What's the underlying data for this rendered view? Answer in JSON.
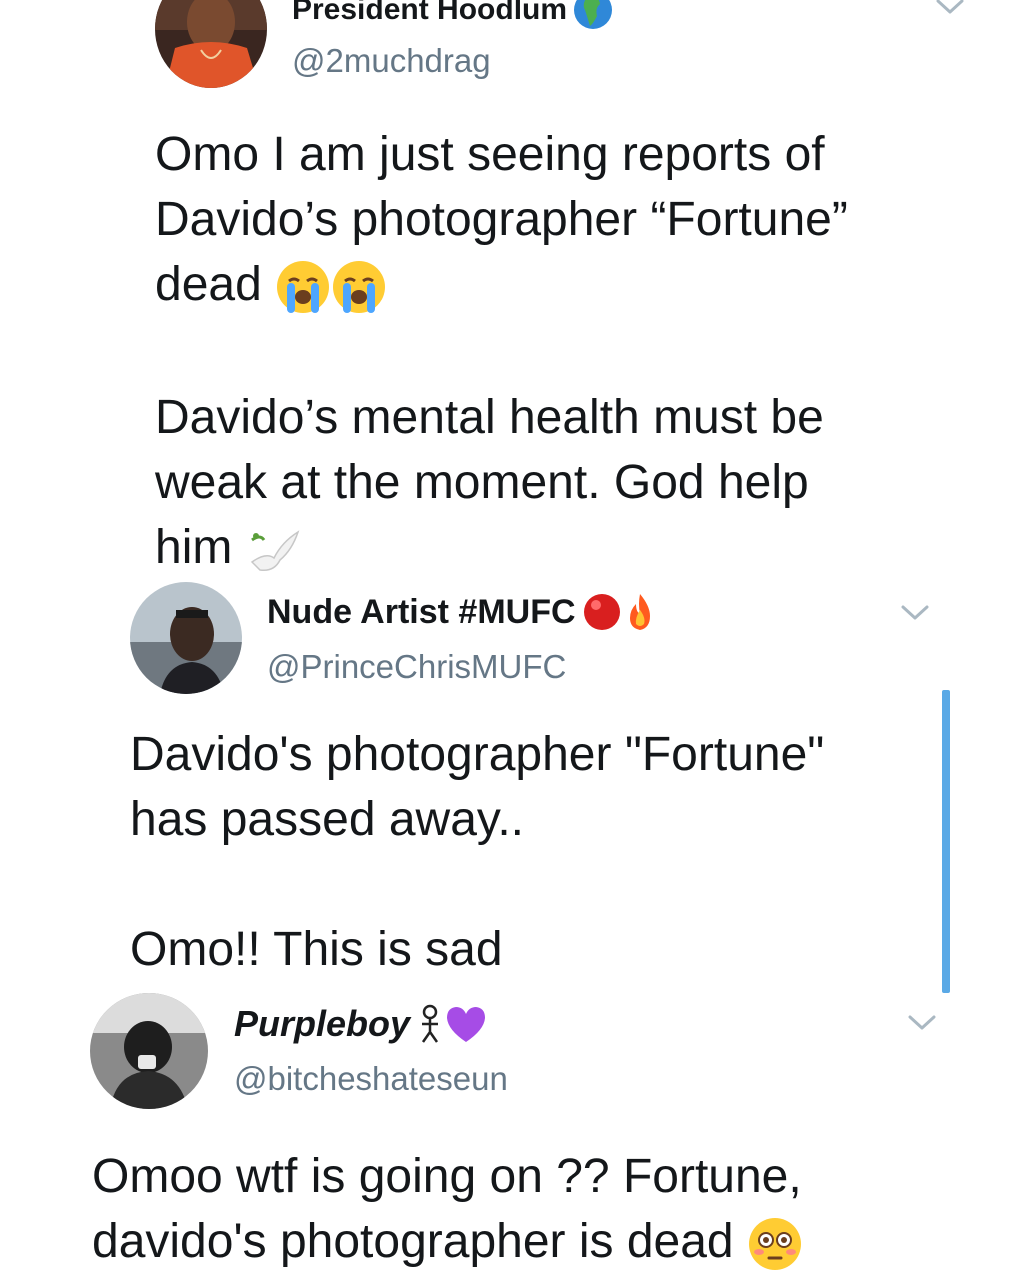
{
  "tweets": [
    {
      "name": "President Hoodlum",
      "name_emoji": "globe-africa-icon",
      "handle": "@2muchdrag",
      "paragraphs": [
        "Omo I am just seeing reports of\nDavido’s photographer “Fortune”\ndead",
        "Davido’s mental health must be\nweak at the moment. God help\nhim"
      ],
      "emojis": [
        "crying-face-icon",
        "crying-face-icon",
        "dove-icon"
      ]
    },
    {
      "name": "Nude Artist #MUFC",
      "name_emoji": [
        "red-circle-icon",
        "fire-icon"
      ],
      "handle": "@PrinceChrisMUFC",
      "paragraphs": [
        "Davido's photographer \"Fortune\"\nhas passed away..",
        "Omo!! This is sad"
      ]
    },
    {
      "name": "Purpleboy",
      "name_emoji": [
        "person-icon",
        "purple-heart-icon"
      ],
      "handle": "@bitcheshateseun",
      "paragraphs": [
        "Omoo wtf is going on ?? Fortune,\ndavido's photographer is dead"
      ],
      "emojis": [
        "flushed-face-icon"
      ]
    }
  ],
  "colors": {
    "text": "#14171a",
    "handle": "#657786",
    "thread_line": "#5aa9e6",
    "chevron": "#aab8c2"
  }
}
